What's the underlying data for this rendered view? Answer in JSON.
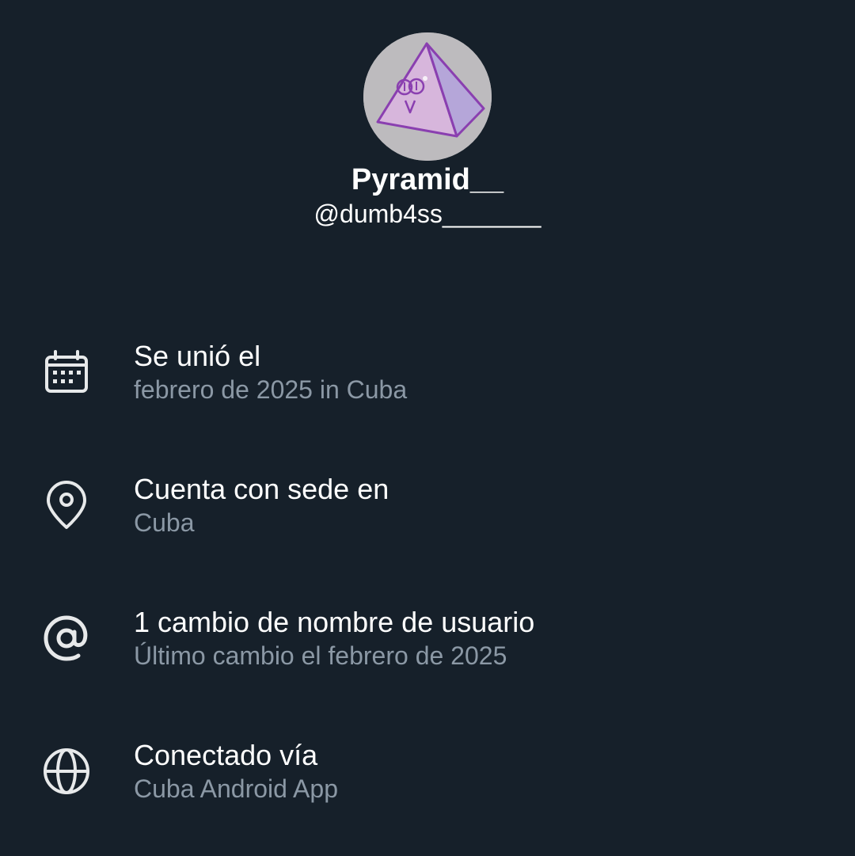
{
  "profile": {
    "display_name": "Pyramid__",
    "handle": "@dumb4ss_______"
  },
  "info": {
    "items": [
      {
        "icon": "calendar-icon",
        "title": "Se unió el",
        "subtitle": "febrero de 2025 in Cuba"
      },
      {
        "icon": "location-pin-icon",
        "title": "Cuenta con sede en",
        "subtitle": "Cuba"
      },
      {
        "icon": "at-sign-icon",
        "title": "1 cambio de nombre de usuario",
        "subtitle": "Último cambio el febrero de 2025"
      },
      {
        "icon": "globe-icon",
        "title": "Conectado vía",
        "subtitle": "Cuba Android App"
      }
    ]
  },
  "colors": {
    "background": "#16202a",
    "primary_text": "#ffffff",
    "secondary_text": "#8b98a5",
    "icon": "#e7e9ea",
    "avatar_bg": "#bdbbbe"
  }
}
